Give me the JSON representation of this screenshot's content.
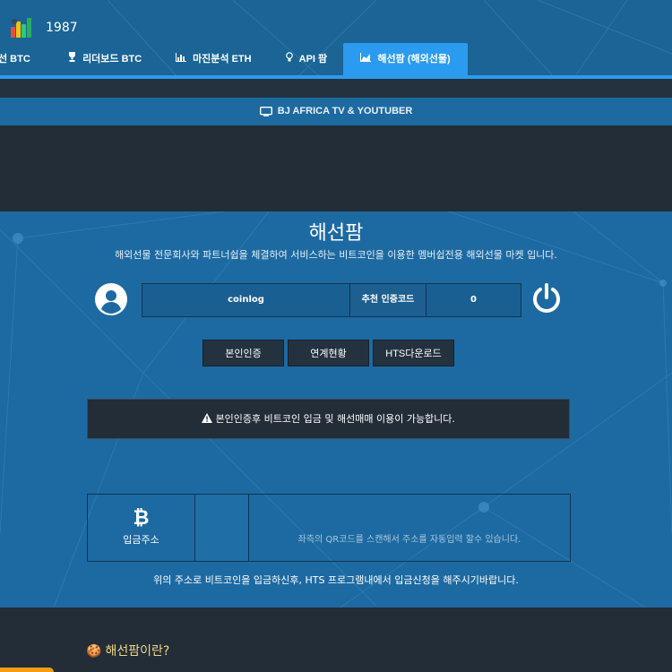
{
  "header": {
    "site_title": "1987",
    "tabs": [
      {
        "label": "선 BTC",
        "icon": ""
      },
      {
        "label": "리더보드 BTC",
        "icon": "trophy-icon"
      },
      {
        "label": "마진분석 ETH",
        "icon": "bar-chart-icon"
      },
      {
        "label": "API 팜",
        "icon": "lightbulb-icon"
      },
      {
        "label": "해선팜 (해외선물)",
        "icon": "area-chart-icon",
        "active": true
      }
    ]
  },
  "bj_bar": {
    "label": "BJ AFRICA TV & YOUTUBER",
    "icon": "tv-icon"
  },
  "main": {
    "title": "해선팜",
    "subtitle": "해외선물 전문회사와 파트너쉽을 체결하여 서비스하는 비트코인을 이용한 멤버쉽전용 해외선물 마켓 입니다.",
    "user": {
      "username": "coinlog",
      "code_label": "추천 인증코드",
      "code_value": "0"
    },
    "buttons": {
      "verify": "본인인증",
      "link_status": "연계현황",
      "hts_download": "HTS다운로드"
    },
    "notice": "본인인증후 비트코인 입금 및 해선매매 이용이 가능합니다.",
    "deposit": {
      "symbol": "₿",
      "label": "입금주소",
      "qr_hint": "좌측의 QR코드를 스캔해서 주소를 자동입력 할수 있습니다."
    },
    "footer_note": "위의 주소로 비트코인을 입금하신후, HTS 프로그램내에서 입금신청을 해주시기바랍니다."
  },
  "bottom": {
    "what_title": "해선팜이란?"
  },
  "colors": {
    "header_bg": "#1a6496",
    "tab_active": "#2b9bf0",
    "main_bg": "#1d6aa2",
    "dark_bg": "#222d38",
    "button_bg": "#243240",
    "accent_yellow": "#f2d780"
  }
}
